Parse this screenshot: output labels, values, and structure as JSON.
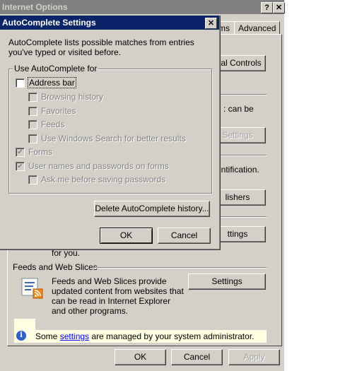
{
  "main_window": {
    "title": "Internet Options",
    "help_glyph": "?",
    "close_glyph": "✕",
    "tabs": [
      {
        "label": "ms"
      },
      {
        "label": "Advanced"
      }
    ],
    "buttons": {
      "rating": "ntal Controls",
      "autocomplete_settings": "Settings",
      "publishers": "lishers",
      "settings2": "ttings",
      "feeds_settings": "Settings",
      "ok": "OK",
      "cancel": "Cancel",
      "apply": "Apply"
    },
    "fragments": {
      "can_be": ": can be",
      "cert": "entification.",
      "for_you": "for you."
    },
    "feeds": {
      "title": "Feeds and Web Slices",
      "text": "Feeds and Web Slices provide updated content from websites that can be read in Internet Explorer and other programs.",
      "icon": "feeds-rss-icon"
    },
    "admin_bar": {
      "text_before": "Some ",
      "link": "settings",
      "text_after": " are managed by your system administrator.",
      "icon": "info-icon"
    }
  },
  "autocomplete_dialog": {
    "title": "AutoComplete Settings",
    "close_glyph": "✕",
    "description": "AutoComplete lists possible matches from entries you've typed or visited before.",
    "group_label": "Use AutoComplete for",
    "options": {
      "address_bar": {
        "label": "Address bar",
        "checked": false,
        "enabled": true
      },
      "browsing_history": {
        "label": "Browsing history",
        "checked": false,
        "enabled": false
      },
      "favorites": {
        "label": "Favorites",
        "checked": false,
        "enabled": false
      },
      "feeds": {
        "label": "Feeds",
        "checked": false,
        "enabled": false
      },
      "windows_search": {
        "label": "Use Windows Search for better results",
        "checked": false,
        "enabled": false
      },
      "forms": {
        "label": "Forms",
        "checked": true,
        "enabled": false
      },
      "usernames": {
        "label": "User names and passwords on forms",
        "checked": true,
        "enabled": false
      },
      "ask_me": {
        "label": "Ask me before saving passwords",
        "checked": false,
        "enabled": false
      }
    },
    "check_glyph": "✔",
    "buttons": {
      "delete_history": "Delete AutoComplete history...",
      "ok": "OK",
      "cancel": "Cancel"
    }
  }
}
